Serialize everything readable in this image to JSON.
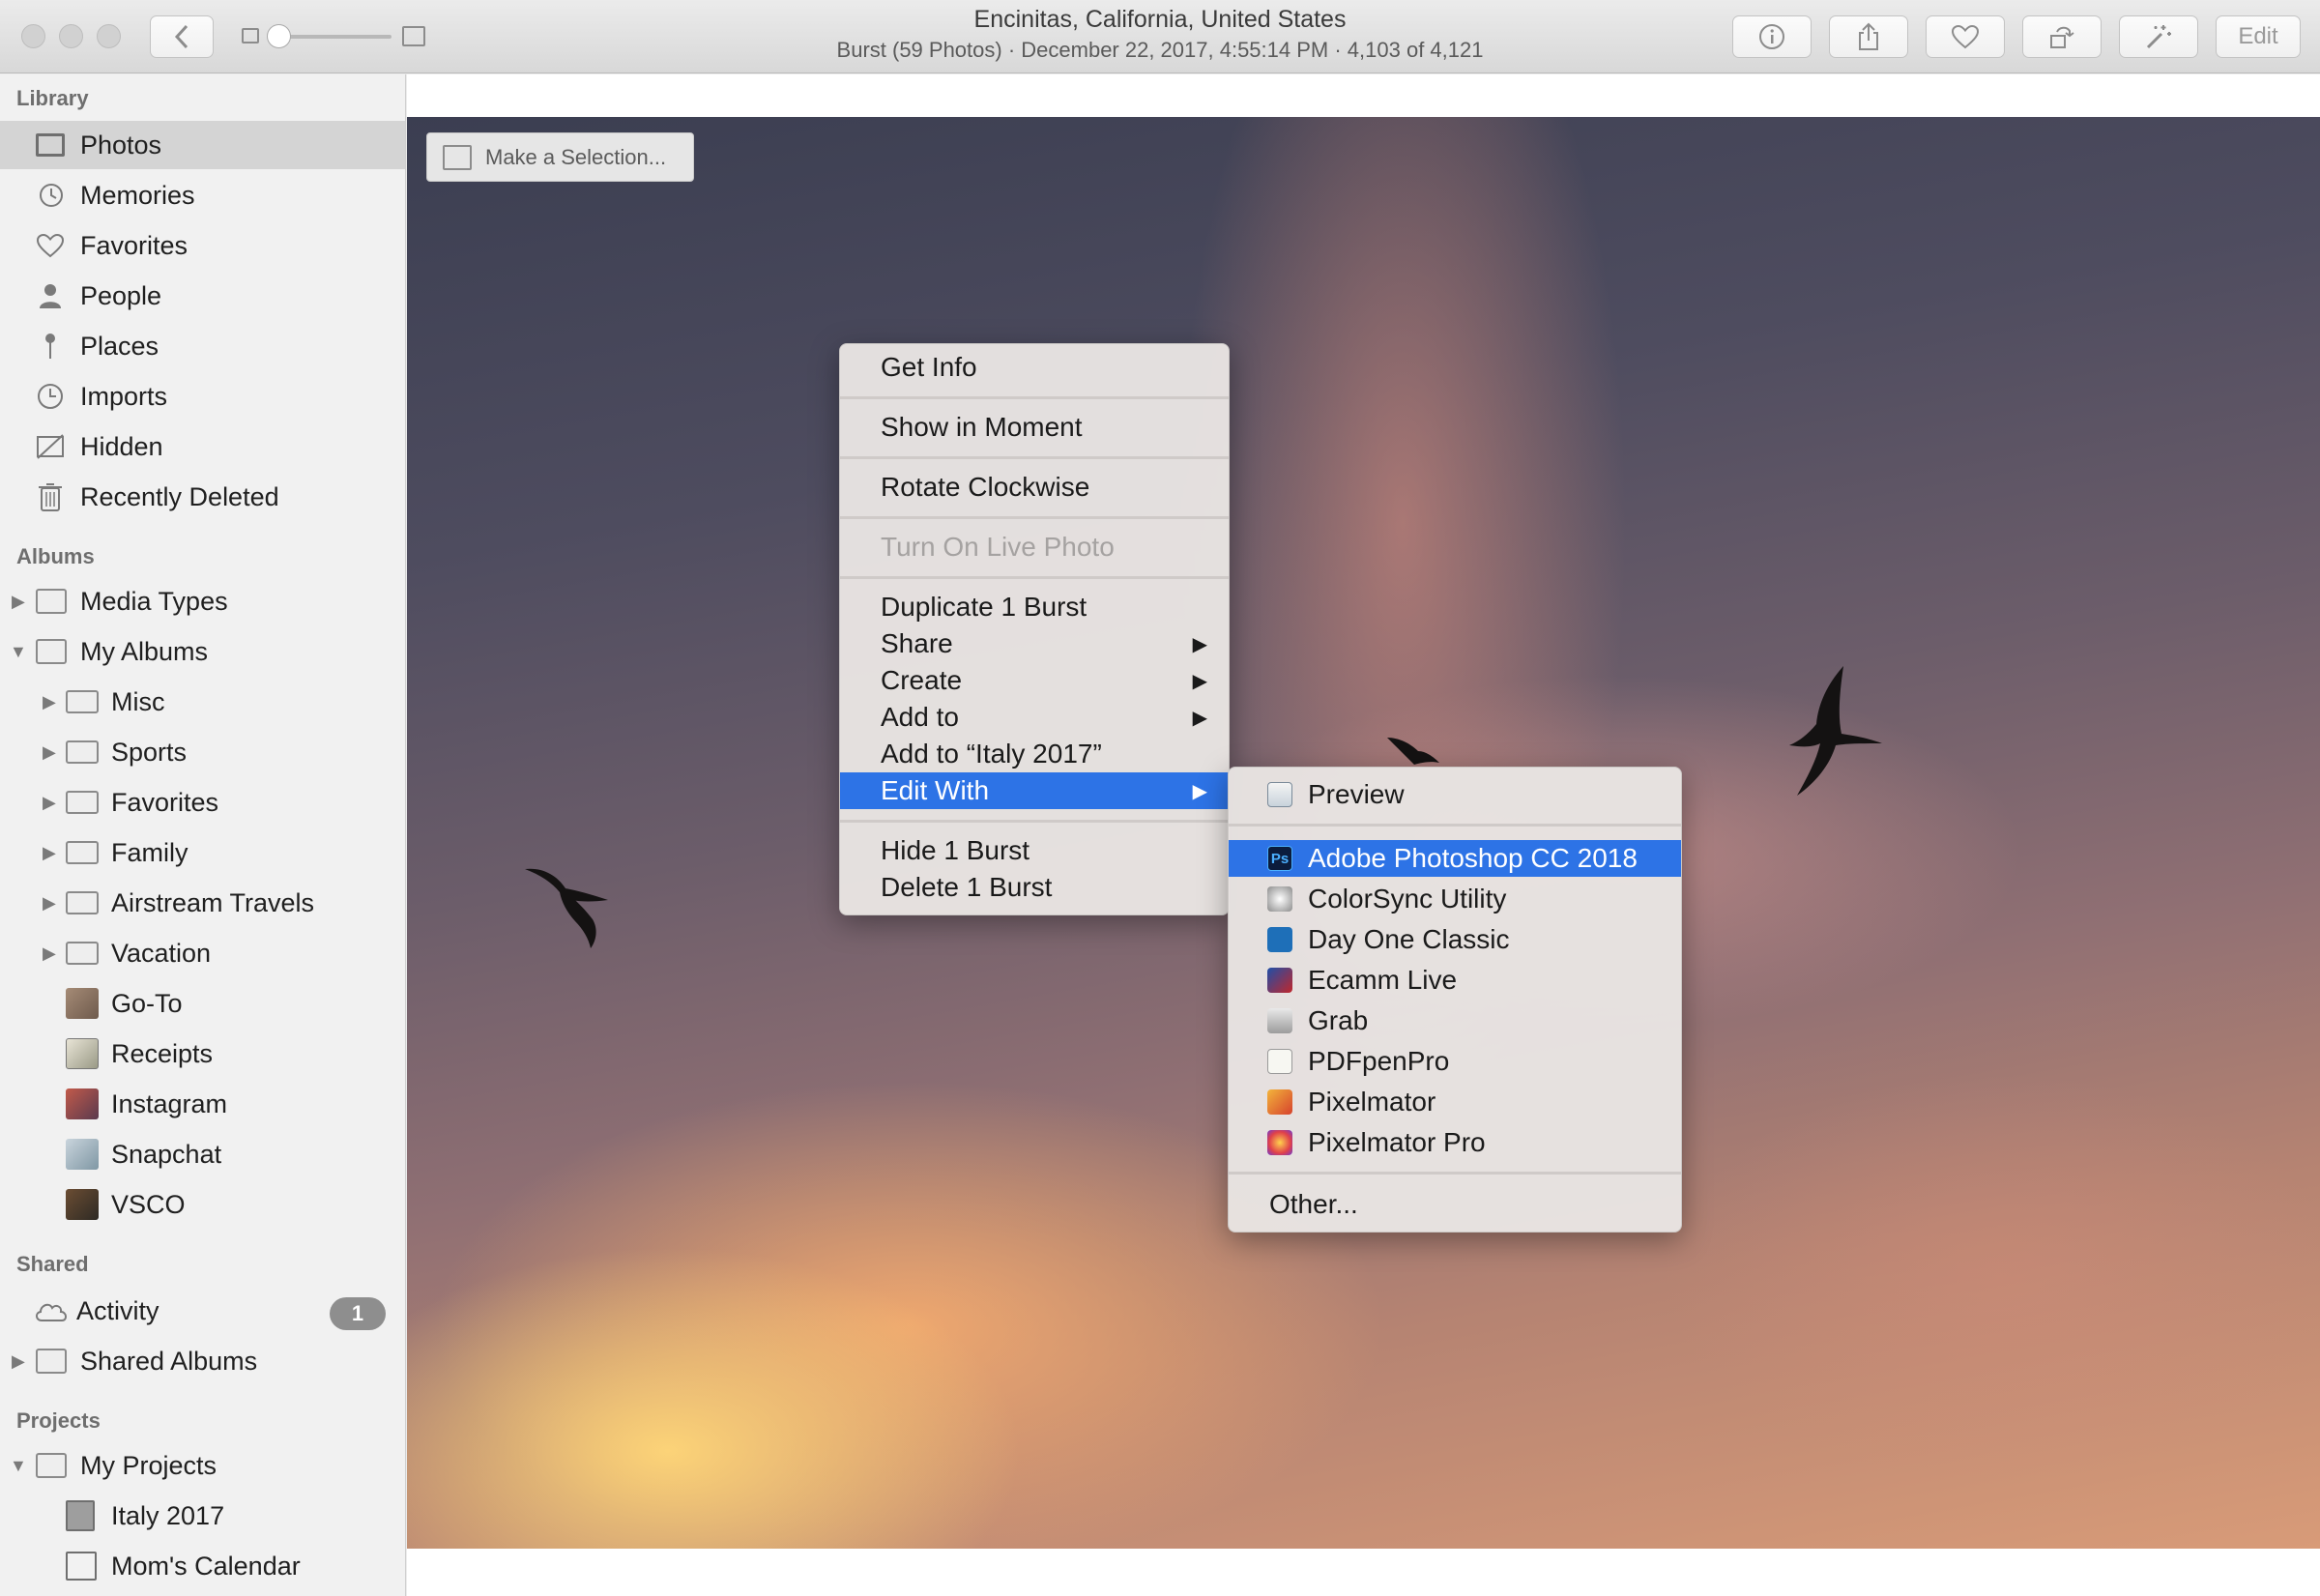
{
  "titlebar": {
    "title": "Encinitas, California, United States",
    "subtitle": "Burst (59 Photos)  ·  December 22, 2017, 4:55:14 PM  ·  4,103 of 4,121",
    "edit_label": "Edit"
  },
  "sidebar": {
    "library_header": "Library",
    "library": [
      "Photos",
      "Memories",
      "Favorites",
      "People",
      "Places",
      "Imports",
      "Hidden",
      "Recently Deleted"
    ],
    "albums_header": "Albums",
    "albums": [
      "Media Types",
      "My Albums",
      "Misc",
      "Sports",
      "Favorites",
      "Family",
      "Airstream Travels",
      "Vacation",
      "Go-To",
      "Receipts",
      "Instagram",
      "Snapchat",
      "VSCO"
    ],
    "shared_header": "Shared",
    "shared": [
      "Activity",
      "Shared Albums"
    ],
    "activity_badge": "1",
    "projects_header": "Projects",
    "projects": [
      "My Projects",
      "Italy 2017",
      "Mom's Calendar"
    ]
  },
  "photo": {
    "make_selection": "Make a Selection..."
  },
  "context_menu": {
    "items": [
      "Get Info",
      "Show in Moment",
      "Rotate Clockwise",
      "Turn On Live Photo",
      "Duplicate 1 Burst",
      "Share",
      "Create",
      "Add to",
      "Add to “Italy 2017”",
      "Edit With",
      "Hide 1 Burst",
      "Delete 1 Burst"
    ],
    "submenu_arrow": "▶"
  },
  "edit_with_menu": {
    "items": [
      "Preview",
      "Adobe Photoshop CC 2018",
      "ColorSync Utility",
      "Day One Classic",
      "Ecamm Live",
      "Grab",
      "PDFpenPro",
      "Pixelmator",
      "Pixelmator Pro",
      "Other..."
    ],
    "ps_icon_text": "Ps",
    "colors": {
      "highlight": "#2d73e6",
      "photoshop": "#0b1c3d"
    }
  }
}
